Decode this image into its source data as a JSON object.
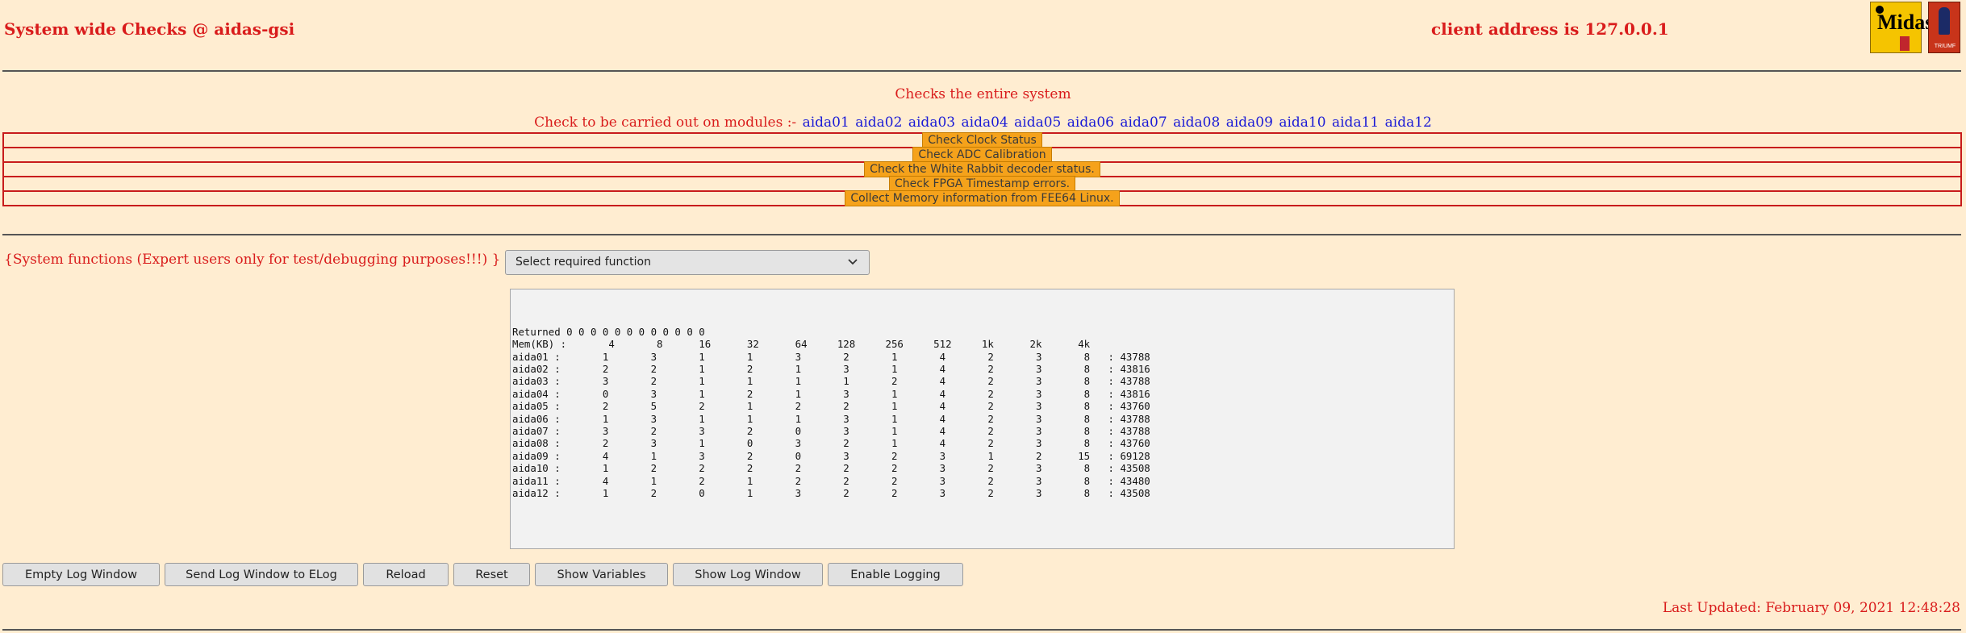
{
  "header": {
    "title": "System wide Checks @ aidas-gsi",
    "client_address": "client address is 127.0.0.1",
    "midas_logo_text": "Midas",
    "triumf_logo_text": "TRIUMF"
  },
  "checks": {
    "description": "Checks the entire system",
    "modules_prefix": "Check to be carried out on modules :-",
    "modules": [
      "aida01",
      "aida02",
      "aida03",
      "aida04",
      "aida05",
      "aida06",
      "aida07",
      "aida08",
      "aida09",
      "aida10",
      "aida11",
      "aida12"
    ],
    "buttons": [
      "Check Clock Status",
      "Check ADC Calibration",
      "Check the White Rabbit decoder status.",
      "Check FPGA Timestamp errors.",
      "Collect Memory information from FEE64 Linux."
    ]
  },
  "system_functions": {
    "label": "{System functions (Expert users only for test/debugging purposes!!!)  } {",
    "select_value": "Select required function"
  },
  "log": {
    "lines": [
      "Returned 0 0 0 0 0 0 0 0 0 0 0 0",
      "Mem(KB) :       4       8      16      32      64     128     256     512     1k      2k      4k",
      "aida01 :       1       3       1       1       3       2       1       4       2       3       8   : 43788",
      "aida02 :       2       2       1       2       1       3       1       4       2       3       8   : 43816",
      "aida03 :       3       2       1       1       1       1       2       4       2       3       8   : 43788",
      "aida04 :       0       3       1       2       1       3       1       4       2       3       8   : 43816",
      "aida05 :       2       5       2       1       2       2       1       4       2       3       8   : 43760",
      "aida06 :       1       3       1       1       1       3       1       4       2       3       8   : 43788",
      "aida07 :       3       2       3       2       0       3       1       4       2       3       8   : 43788",
      "aida08 :       2       3       1       0       3       2       1       4       2       3       8   : 43760",
      "aida09 :       4       1       3       2       0       3       2       3       1       2      15   : 69128",
      "aida10 :       1       2       2       2       2       2       2       3       2       3       8   : 43508",
      "aida11 :       4       1       2       1       2       2       2       3       2       3       8   : 43480",
      "aida12 :       1       2       0       1       3       2       2       3       2       3       8   : 43508"
    ]
  },
  "bottom_buttons": [
    "Empty Log Window",
    "Send Log Window to ELog",
    "Reload",
    "Reset",
    "Show Variables",
    "Show Log Window",
    "Enable Logging"
  ],
  "footer": {
    "last_updated": "Last Updated: February 09, 2021 12:48:28"
  },
  "colors": {
    "background": "#ffedd1",
    "text_red": "#d91c1c",
    "link_blue": "#1a1ad6",
    "button_orange": "#f5a21b"
  }
}
